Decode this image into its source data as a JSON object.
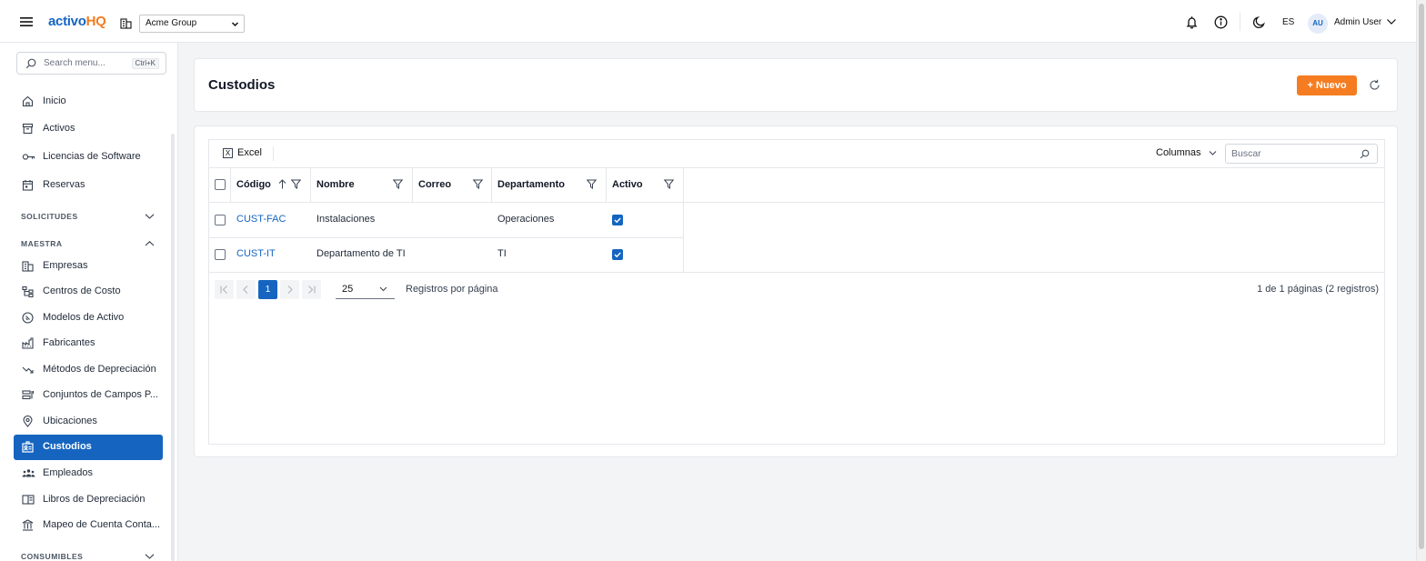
{
  "app": {
    "logo_part1": "activo",
    "logo_part2": "HQ",
    "company": "Acme Group",
    "language": "ES",
    "user_initials": "AU",
    "user_name": "Admin User",
    "brand_color": "#1565c0",
    "accent_color": "#f57c20"
  },
  "sidebar": {
    "search_placeholder": "Search menu...",
    "search_shortcut": "Ctrl+K",
    "items": [
      {
        "label": "Inicio",
        "icon": "home-icon"
      },
      {
        "label": "Activos",
        "icon": "archive-icon"
      },
      {
        "label": "Licencias de Software",
        "icon": "key-icon"
      },
      {
        "label": "Reservas",
        "icon": "calendar-icon"
      }
    ],
    "sections": [
      {
        "label": "SOLICITUDES",
        "expanded": false
      },
      {
        "label": "MAESTRA",
        "expanded": true
      },
      {
        "label": "CONSUMIBLES",
        "expanded": false
      }
    ],
    "maestra_items": [
      {
        "label": "Empresas",
        "icon": "building-icon"
      },
      {
        "label": "Centros de Costo",
        "icon": "hierarchy-icon"
      },
      {
        "label": "Modelos de Activo",
        "icon": "model-icon"
      },
      {
        "label": "Fabricantes",
        "icon": "factory-icon"
      },
      {
        "label": "Métodos de Depreciación",
        "icon": "trending-down-icon"
      },
      {
        "label": "Conjuntos de Campos P...",
        "icon": "form-fields-icon"
      },
      {
        "label": "Ubicaciones",
        "icon": "map-pin-icon"
      },
      {
        "label": "Custodios",
        "icon": "id-badge-icon",
        "active": true
      },
      {
        "label": "Empleados",
        "icon": "users-icon"
      },
      {
        "label": "Libros de Depreciación",
        "icon": "book-icon"
      },
      {
        "label": "Mapeo de Cuenta Conta...",
        "icon": "bank-icon"
      }
    ]
  },
  "page": {
    "title": "Custodios",
    "new_button": "+ Nuevo"
  },
  "grid": {
    "excel_label": "Excel",
    "columns_button": "Columnas",
    "search_placeholder": "Buscar",
    "headers": [
      "Código",
      "Nombre",
      "Correo",
      "Departamento",
      "Activo"
    ],
    "sort": {
      "column": "Código",
      "direction": "asc"
    },
    "rows": [
      {
        "codigo": "CUST-FAC",
        "nombre": "Instalaciones",
        "correo": "",
        "departamento": "Operaciones",
        "activo": true
      },
      {
        "codigo": "CUST-IT",
        "nombre": "Departamento de TI",
        "correo": "",
        "departamento": "TI",
        "activo": true
      }
    ],
    "pager": {
      "current_page": "1",
      "page_size": "25",
      "per_page_label": "Registros por página",
      "info": "1 de 1 páginas (2 registros)"
    }
  }
}
